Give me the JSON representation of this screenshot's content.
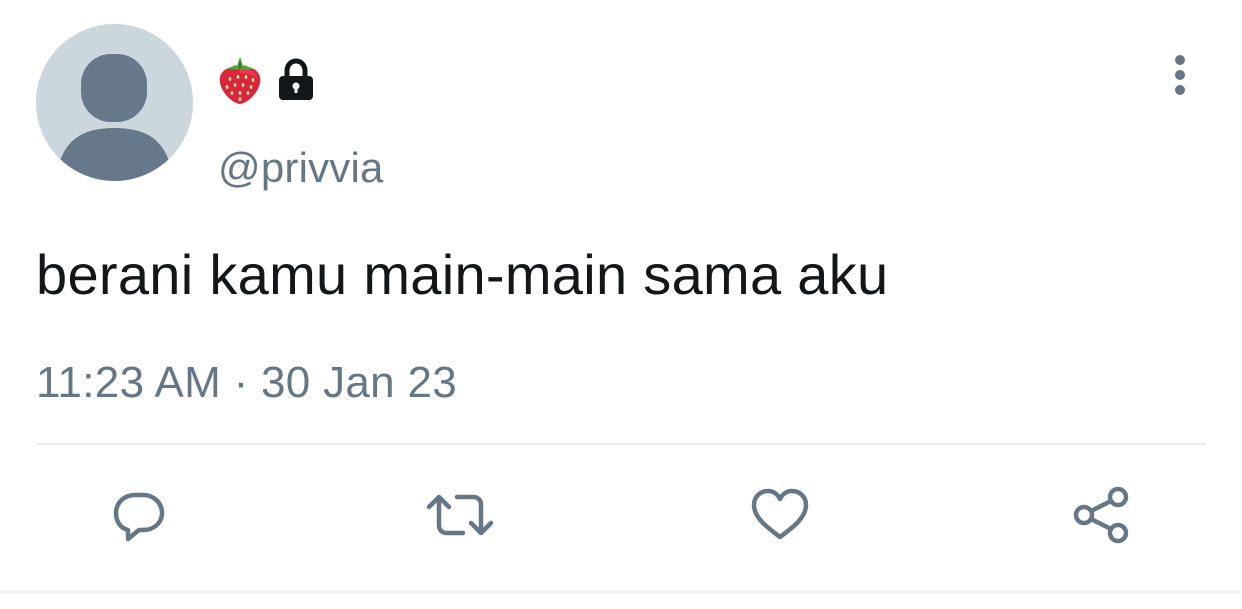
{
  "tweet": {
    "author": {
      "display_name_icons": [
        "strawberry-icon",
        "lock-icon"
      ],
      "handle": "@privvia"
    },
    "text": "berani kamu main-main sama aku",
    "timestamp": "11:23 AM · 30 Jan 23"
  },
  "actions": [
    {
      "name": "reply",
      "icon": "reply-icon"
    },
    {
      "name": "retweet",
      "icon": "retweet-icon"
    },
    {
      "name": "like",
      "icon": "heart-icon"
    },
    {
      "name": "share",
      "icon": "share-icon"
    }
  ],
  "colors": {
    "text_primary": "#14171a",
    "text_secondary": "#657786",
    "icon": "#657786",
    "avatar_bg": "#ccd6dd",
    "avatar_fg": "#66788a",
    "divider": "#e6ecf0",
    "strawberry": "#d9263b"
  }
}
